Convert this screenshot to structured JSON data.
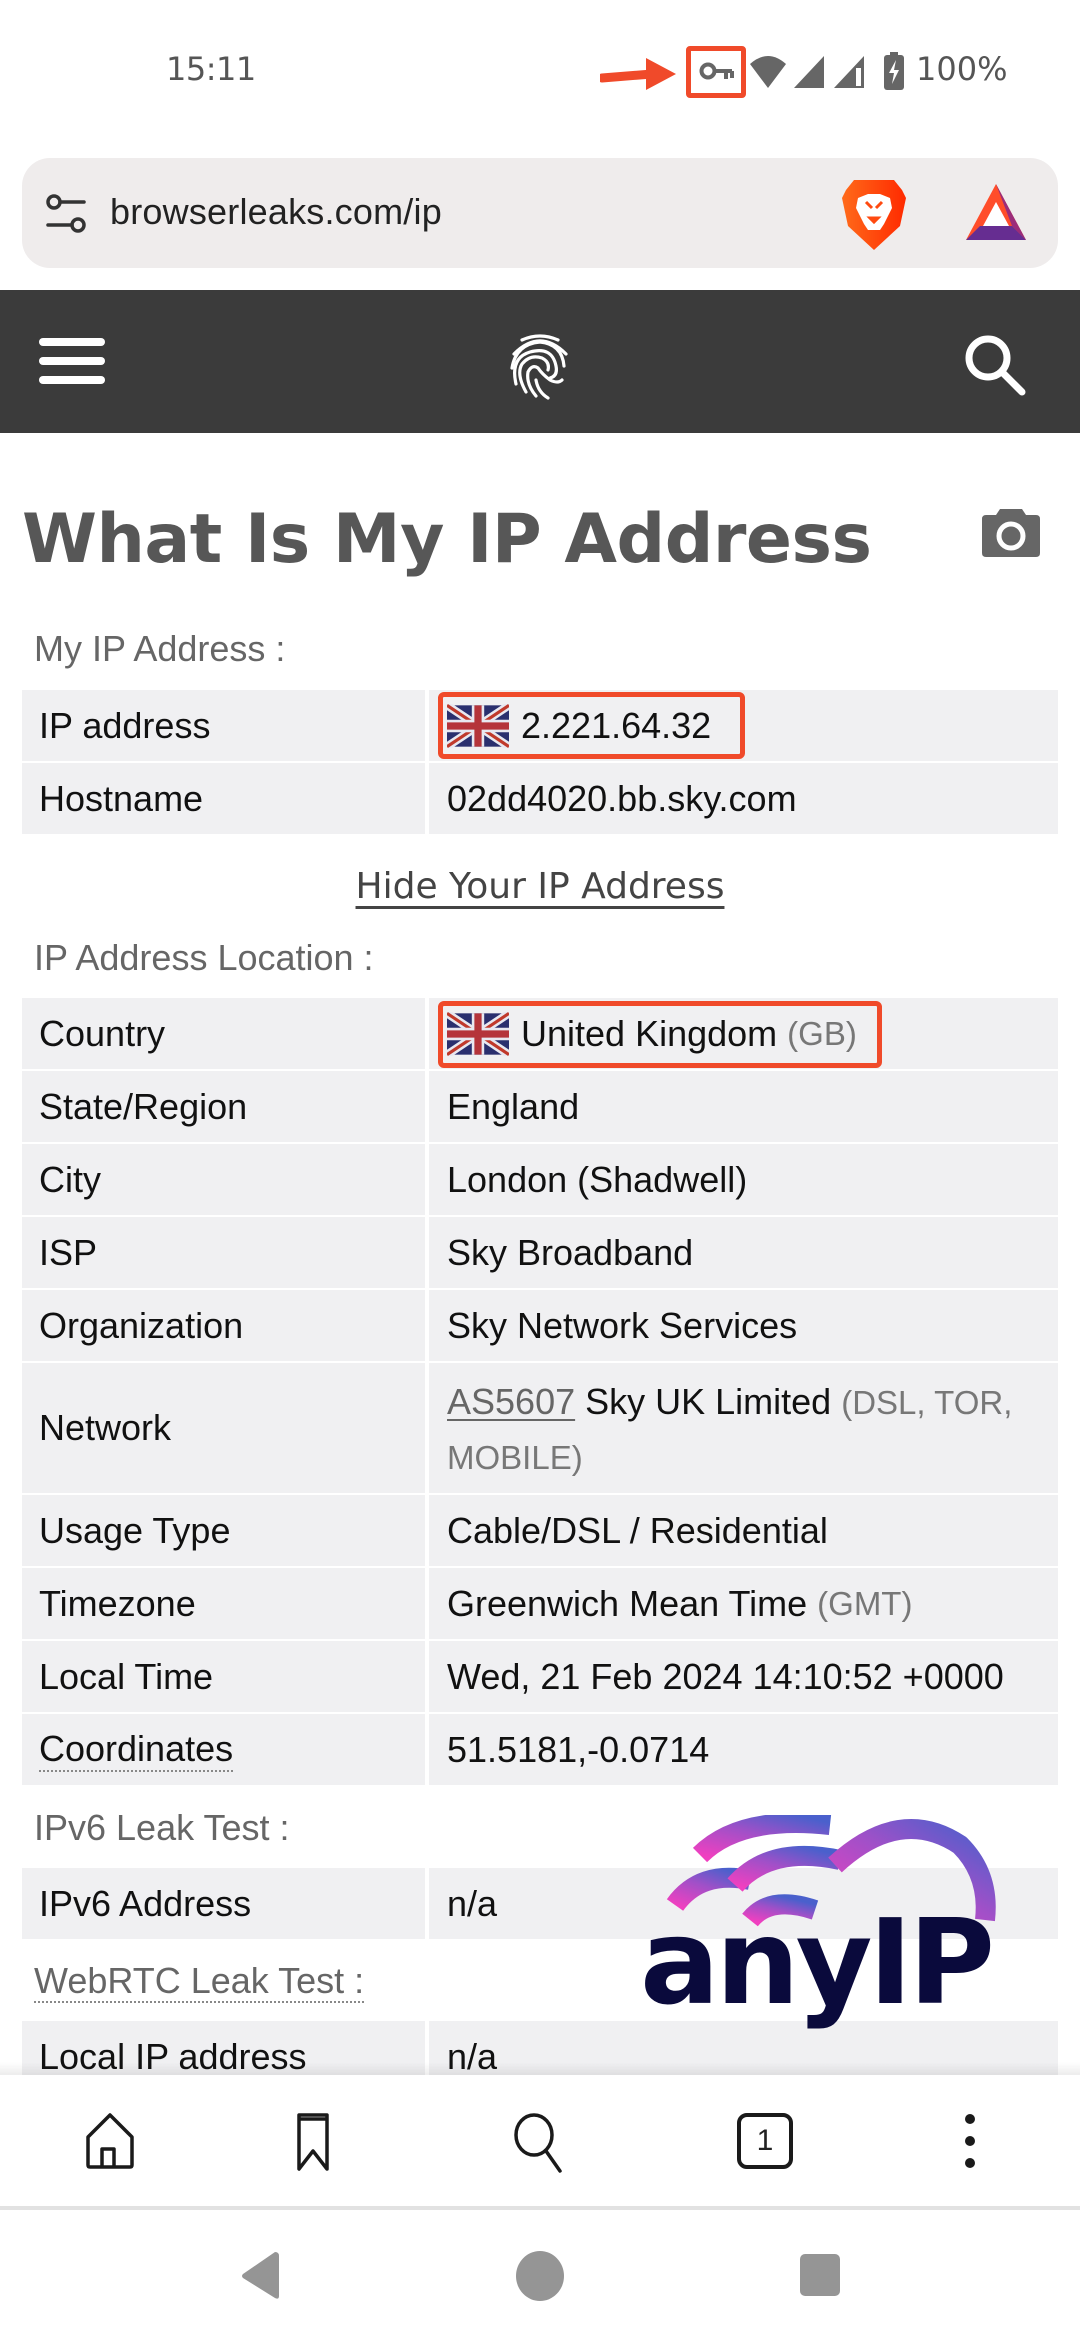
{
  "status_bar": {
    "time": "15:11",
    "battery": "100%",
    "icons": [
      "annotation-arrow",
      "vpn-key-icon",
      "wifi-icon",
      "signal-icon",
      "signal-icon-2",
      "battery-charging-icon"
    ]
  },
  "browser": {
    "url": "browserleaks.com/ip",
    "icons": [
      "site-settings-icon",
      "brave-shields-icon",
      "brave-rewards-icon"
    ]
  },
  "site_header": {
    "icons": [
      "menu-icon",
      "fingerprint-logo-icon",
      "search-icon"
    ]
  },
  "page": {
    "title": "What Is My IP Address",
    "camera_icon": "camera-icon",
    "sections": {
      "my_ip": {
        "label": "My IP Address :",
        "rows": [
          {
            "key": "IP address",
            "value": "2.221.64.32",
            "flag": "uk-flag-icon",
            "highlighted": true
          },
          {
            "key": "Hostname",
            "value": "02dd4020.bb.sky.com"
          }
        ]
      },
      "hide_link": "Hide Your IP Address",
      "location": {
        "label": "IP Address Location :",
        "rows": [
          {
            "key": "Country",
            "value": "United Kingdom",
            "suffix": "(GB)",
            "flag": "uk-flag-icon",
            "highlighted": true
          },
          {
            "key": "State/Region",
            "value": "England"
          },
          {
            "key": "City",
            "value": "London (Shadwell)"
          },
          {
            "key": "ISP",
            "value": "Sky Broadband"
          },
          {
            "key": "Organization",
            "value": "Sky Network Services"
          },
          {
            "key": "Network",
            "link": "AS5607",
            "value": "Sky UK Limited",
            "suffix": "(DSL, TOR, MOBILE)"
          },
          {
            "key": "Usage Type",
            "value": "Cable/DSL / Residential"
          },
          {
            "key": "Timezone",
            "value": "Greenwich Mean Time",
            "suffix": "(GMT)"
          },
          {
            "key": "Local Time",
            "value": "Wed, 21 Feb 2024 14:10:52 +0000"
          },
          {
            "key": "Coordinates",
            "value": "51.5181,-0.0714"
          }
        ]
      },
      "ipv6": {
        "label": "IPv6 Leak Test :",
        "rows": [
          {
            "key": "IPv6 Address",
            "value": "n/a"
          }
        ]
      },
      "webrtc": {
        "label": "WebRTC Leak Test :",
        "rows": [
          {
            "key": "Local IP address",
            "value": "n/a"
          }
        ]
      }
    },
    "watermark": "anyIP"
  },
  "bottom_toolbar": {
    "tab_count": "1",
    "icons": [
      "home-icon",
      "bookmark-icon",
      "search-icon",
      "tabs-icon",
      "more-vert-icon"
    ]
  },
  "nav_bar": {
    "icons": [
      "back-icon",
      "home-circle-icon",
      "recents-icon"
    ]
  },
  "colors": {
    "annotation": "#f04a2a",
    "header_bg": "#3b3b3b",
    "row_bg": "#f0f0f2",
    "url_bar_bg": "#efecec",
    "watermark_text": "#0a0a3c"
  }
}
